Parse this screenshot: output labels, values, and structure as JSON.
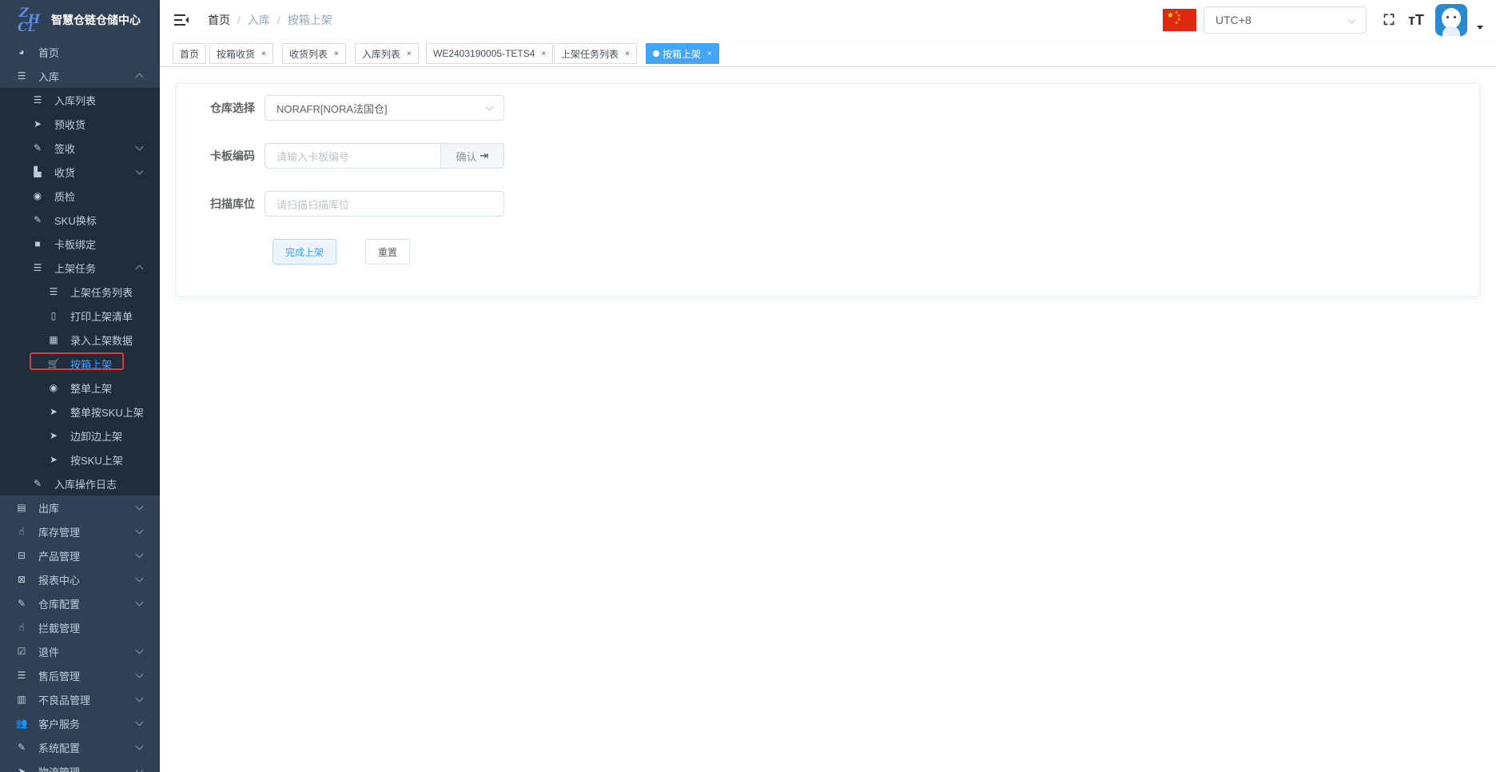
{
  "app": {
    "title": "智慧仓链仓储中心",
    "logo_letters": [
      "Z",
      "H",
      "C",
      "L"
    ]
  },
  "sidebar": {
    "items": [
      {
        "label": "首页",
        "icon": "dashboard-icon",
        "level": 1
      },
      {
        "label": "入库",
        "icon": "list-icon",
        "level": 1,
        "expanded": true
      },
      {
        "label": "入库列表",
        "icon": "list-icon",
        "level": 2
      },
      {
        "label": "预收货",
        "icon": "send-icon",
        "level": 2
      },
      {
        "label": "签收",
        "icon": "edit-icon",
        "level": 2,
        "expandable": true
      },
      {
        "label": "收货",
        "icon": "clapperboard-icon",
        "level": 2,
        "expandable": true
      },
      {
        "label": "质检",
        "icon": "eye-icon",
        "level": 2
      },
      {
        "label": "SKU换标",
        "icon": "edit-icon",
        "level": 2
      },
      {
        "label": "卡板绑定",
        "icon": "lock-icon",
        "level": 2
      },
      {
        "label": "上架任务",
        "icon": "list-icon",
        "level": 2,
        "expanded": true
      },
      {
        "label": "上架任务列表",
        "icon": "list-icon",
        "level": 3
      },
      {
        "label": "打印上架清单",
        "icon": "book-icon",
        "level": 3
      },
      {
        "label": "录入上架数据",
        "icon": "table-icon",
        "level": 3
      },
      {
        "label": "按箱上架",
        "icon": "cart-icon",
        "level": 3,
        "active": true
      },
      {
        "label": "整单上架",
        "icon": "radio-icon",
        "level": 3
      },
      {
        "label": "整单按SKU上架",
        "icon": "send-icon",
        "level": 3
      },
      {
        "label": "边卸边上架",
        "icon": "send-icon",
        "level": 3
      },
      {
        "label": "按SKU上架",
        "icon": "send-icon",
        "level": 3
      },
      {
        "label": "入库操作日志",
        "icon": "edit-icon",
        "level": 2
      },
      {
        "label": "出库",
        "icon": "monitor-icon",
        "level": 1,
        "expandable": true
      },
      {
        "label": "库存管理",
        "icon": "hand-icon",
        "level": 1,
        "expandable": true
      },
      {
        "label": "产品管理",
        "icon": "briefcase-icon",
        "level": 1,
        "expandable": true
      },
      {
        "label": "报表中心",
        "icon": "chart-icon",
        "level": 1,
        "expandable": true
      },
      {
        "label": "仓库配置",
        "icon": "edit-icon",
        "level": 1,
        "expandable": true
      },
      {
        "label": "拦截管理",
        "icon": "hand-icon",
        "level": 1
      },
      {
        "label": "退件",
        "icon": "checkbox-icon",
        "level": 1,
        "expandable": true
      },
      {
        "label": "售后管理",
        "icon": "list-icon",
        "level": 1,
        "expandable": true
      },
      {
        "label": "不良品管理",
        "icon": "server-icon",
        "level": 1,
        "expandable": true
      },
      {
        "label": "客户服务",
        "icon": "peoples-icon",
        "level": 1,
        "expandable": true
      },
      {
        "label": "系统配置",
        "icon": "edit-icon",
        "level": 1,
        "expandable": true
      },
      {
        "label": "物流管理",
        "icon": "send-icon",
        "level": 1,
        "expandable": true
      }
    ]
  },
  "navbar": {
    "breadcrumb": [
      "首页",
      "入库",
      "按箱上架"
    ],
    "timezone": "UTC+8"
  },
  "tags": [
    {
      "label": "首页",
      "closable": false
    },
    {
      "label": "按箱收货",
      "closable": true
    },
    {
      "label": "收货列表",
      "closable": true
    },
    {
      "label": "入库列表",
      "closable": true
    },
    {
      "label": "WE2403190005-TETS4",
      "closable": true
    },
    {
      "label": "上架任务列表",
      "closable": true
    },
    {
      "label": "按箱上架",
      "closable": true,
      "active": true
    }
  ],
  "form": {
    "warehouse_label": "仓库选择",
    "warehouse_value": "NORAFR[NORA法国仓]",
    "pallet_label": "卡板编码",
    "pallet_placeholder": "请输入卡板编号",
    "confirm_label": "确认",
    "location_label": "扫描库位",
    "location_placeholder": "请扫描扫描库位",
    "complete_label": "完成上架",
    "reset_label": "重置"
  },
  "colors": {
    "sidebar_bg": "#304156",
    "active": "#409eff",
    "tag_active": "#42a5f5",
    "highlight": "#e53935"
  }
}
